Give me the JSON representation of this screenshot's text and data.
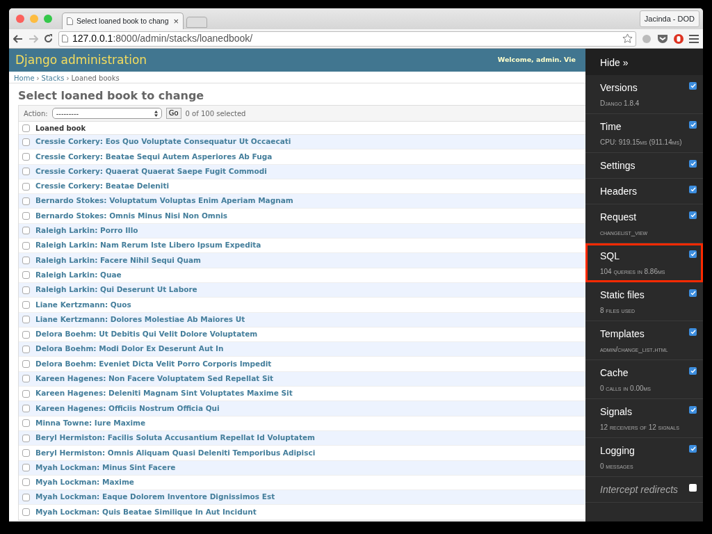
{
  "browser": {
    "tab_title": "Select loaned book to chang",
    "tab_close": "×",
    "profile": "Jacinda - DOD",
    "url_host": "127.0.0.1",
    "url_path": ":8000/admin/stacks/loanedbook/"
  },
  "header": {
    "brand": "Django administration",
    "welcome": "Welcome, ",
    "user": "admin",
    "links": ". Vie"
  },
  "breadcrumbs": [
    "Home",
    "Stacks",
    "Loaned books"
  ],
  "breadcrumb_separator": "›",
  "title": "Select loaned book to change",
  "actions": {
    "label": "Action:",
    "select": "---------",
    "go": "Go",
    "counter": "0 of 100 selected"
  },
  "table": {
    "column": "Loaned book",
    "select_all": false,
    "rows": [
      {
        "text": "Cressie Corkery: Eos Quo Voluptate Consequatur Ut Occaecati",
        "checked": false
      },
      {
        "text": "Cressie Corkery: Beatae Sequi Autem Asperiores Ab Fuga",
        "checked": false
      },
      {
        "text": "Cressie Corkery: Quaerat Quaerat Saepe Fugit Commodi",
        "checked": false
      },
      {
        "text": "Cressie Corkery: Beatae Deleniti",
        "checked": false
      },
      {
        "text": "Bernardo Stokes: Voluptatum Voluptas Enim Aperiam Magnam",
        "checked": false
      },
      {
        "text": "Bernardo Stokes: Omnis Minus Nisi Non Omnis",
        "checked": false
      },
      {
        "text": "Raleigh Larkin: Porro Illo",
        "checked": false
      },
      {
        "text": "Raleigh Larkin: Nam Rerum Iste Libero Ipsum Expedita",
        "checked": false
      },
      {
        "text": "Raleigh Larkin: Facere Nihil Sequi Quam",
        "checked": false
      },
      {
        "text": "Raleigh Larkin: Quae",
        "checked": false
      },
      {
        "text": "Raleigh Larkin: Qui Deserunt Ut Labore",
        "checked": false
      },
      {
        "text": "Liane Kertzmann: Quos",
        "checked": false
      },
      {
        "text": "Liane Kertzmann: Dolores Molestiae Ab Maiores Ut",
        "checked": false
      },
      {
        "text": "Delora Boehm: Ut Debitis Qui Velit Dolore Voluptatem",
        "checked": false
      },
      {
        "text": "Delora Boehm: Modi Dolor Ex Deserunt Aut In",
        "checked": false
      },
      {
        "text": "Delora Boehm: Eveniet Dicta Velit Porro Corporis Impedit",
        "checked": false
      },
      {
        "text": "Kareen Hagenes: Non Facere Voluptatem Sed Repellat Sit",
        "checked": false
      },
      {
        "text": "Kareen Hagenes: Deleniti Magnam Sint Voluptates Maxime Sit",
        "checked": false
      },
      {
        "text": "Kareen Hagenes: Officiis Nostrum Officia Qui",
        "checked": false
      },
      {
        "text": "Minna Towne: Iure Maxime",
        "checked": false
      },
      {
        "text": "Beryl Hermiston: Facilis Soluta Accusantium Repellat Id Voluptatem",
        "checked": false
      },
      {
        "text": "Beryl Hermiston: Omnis Aliquam Quasi Deleniti Temporibus Adipisci",
        "checked": false
      },
      {
        "text": "Myah Lockman: Minus Sint Facere",
        "checked": false
      },
      {
        "text": "Myah Lockman: Maxime",
        "checked": false
      },
      {
        "text": "Myah Lockman: Eaque Dolorem Inventore Dignissimos Est",
        "checked": false
      },
      {
        "text": "Myah Lockman: Quis Beatae Similique In Aut Incidunt",
        "checked": false
      }
    ]
  },
  "toolbar": {
    "hide": "Hide »",
    "panels": [
      {
        "title": "Versions",
        "subtitle": "Django 1.8.4",
        "checked": true,
        "highlighted": false
      },
      {
        "title": "Time",
        "subtitle": "CPU: 919.15ms (911.14ms)",
        "checked": true,
        "highlighted": false
      },
      {
        "title": "Settings",
        "checked": true,
        "highlighted": false
      },
      {
        "title": "Headers",
        "checked": true,
        "highlighted": false
      },
      {
        "title": "Request",
        "subtitle": "changelist_view",
        "checked": true,
        "highlighted": false
      },
      {
        "title": "SQL",
        "subtitle": "104 queries in 8.86ms",
        "checked": true,
        "highlighted": true
      },
      {
        "title": "Static files",
        "subtitle": "8 files used",
        "checked": true,
        "highlighted": false
      },
      {
        "title": "Templates",
        "subtitle": "admin/change_list.html",
        "checked": true,
        "highlighted": false
      },
      {
        "title": "Cache",
        "subtitle": "0 calls in 0.00ms",
        "checked": true,
        "highlighted": false
      },
      {
        "title": "Signals",
        "subtitle": "12 receivers of 12 signals",
        "checked": true,
        "highlighted": false
      },
      {
        "title": "Logging",
        "subtitle": "0 messages",
        "checked": true,
        "highlighted": false
      },
      {
        "title": "Intercept redirects",
        "checked": false,
        "highlighted": false,
        "italic": true
      }
    ]
  }
}
